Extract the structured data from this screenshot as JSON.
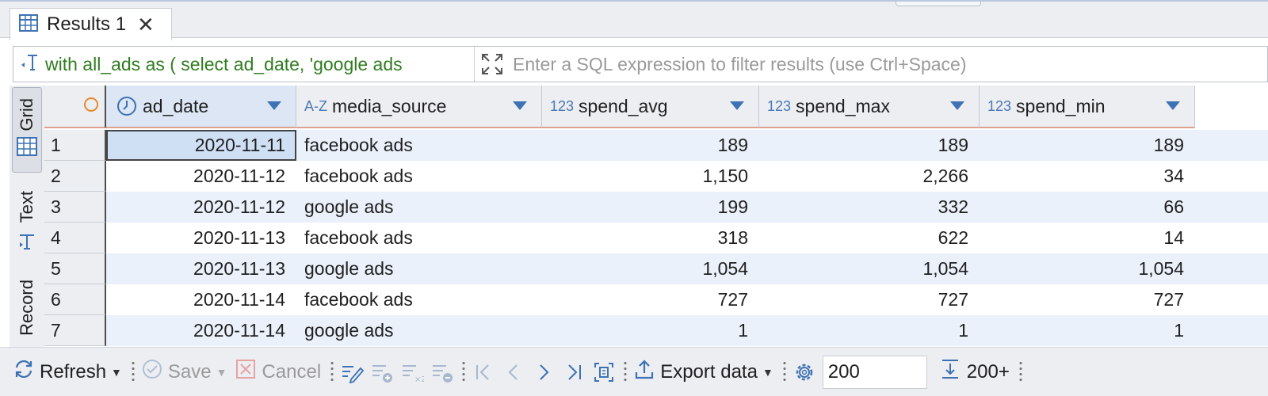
{
  "tab": {
    "label": "Results 1"
  },
  "filter": {
    "query_text": "with all_ads as ( select ad_date, 'google ads",
    "placeholder": "Enter a SQL expression to filter results (use Ctrl+Space)"
  },
  "sidebar": {
    "tabs": [
      "Grid",
      "Text",
      "Record"
    ]
  },
  "columns": [
    {
      "name": "ad_date",
      "type_label": "",
      "type_icon": "clock-icon"
    },
    {
      "name": "media_source",
      "type_label": "A-Z",
      "type_icon": "text-type-icon"
    },
    {
      "name": "spend_avg",
      "type_label": "123",
      "type_icon": "number-type-icon"
    },
    {
      "name": "spend_max",
      "type_label": "123",
      "type_icon": "number-type-icon"
    },
    {
      "name": "spend_min",
      "type_label": "123",
      "type_icon": "number-type-icon"
    }
  ],
  "rows": [
    {
      "num": "1",
      "ad_date": "2020-11-11",
      "media_source": "facebook ads",
      "spend_avg": "189",
      "spend_max": "189",
      "spend_min": "189"
    },
    {
      "num": "2",
      "ad_date": "2020-11-12",
      "media_source": "facebook ads",
      "spend_avg": "1,150",
      "spend_max": "2,266",
      "spend_min": "34"
    },
    {
      "num": "3",
      "ad_date": "2020-11-12",
      "media_source": "google ads",
      "spend_avg": "199",
      "spend_max": "332",
      "spend_min": "66"
    },
    {
      "num": "4",
      "ad_date": "2020-11-13",
      "media_source": "facebook ads",
      "spend_avg": "318",
      "spend_max": "622",
      "spend_min": "14"
    },
    {
      "num": "5",
      "ad_date": "2020-11-13",
      "media_source": "google ads",
      "spend_avg": "1,054",
      "spend_max": "1,054",
      "spend_min": "1,054"
    },
    {
      "num": "6",
      "ad_date": "2020-11-14",
      "media_source": "facebook ads",
      "spend_avg": "727",
      "spend_max": "727",
      "spend_min": "727"
    },
    {
      "num": "7",
      "ad_date": "2020-11-14",
      "media_source": "google ads",
      "spend_avg": "1",
      "spend_max": "1",
      "spend_min": "1"
    }
  ],
  "toolbar": {
    "refresh": "Refresh",
    "save": "Save",
    "cancel": "Cancel",
    "export": "Export data",
    "fetch_size": "200",
    "fetch_all": "200+"
  },
  "colors": {
    "accent": "#3d72b4",
    "row_alt": "#eaf1fb",
    "filter_text": "#2e7d1f",
    "header_underline": "#e0a08e"
  }
}
